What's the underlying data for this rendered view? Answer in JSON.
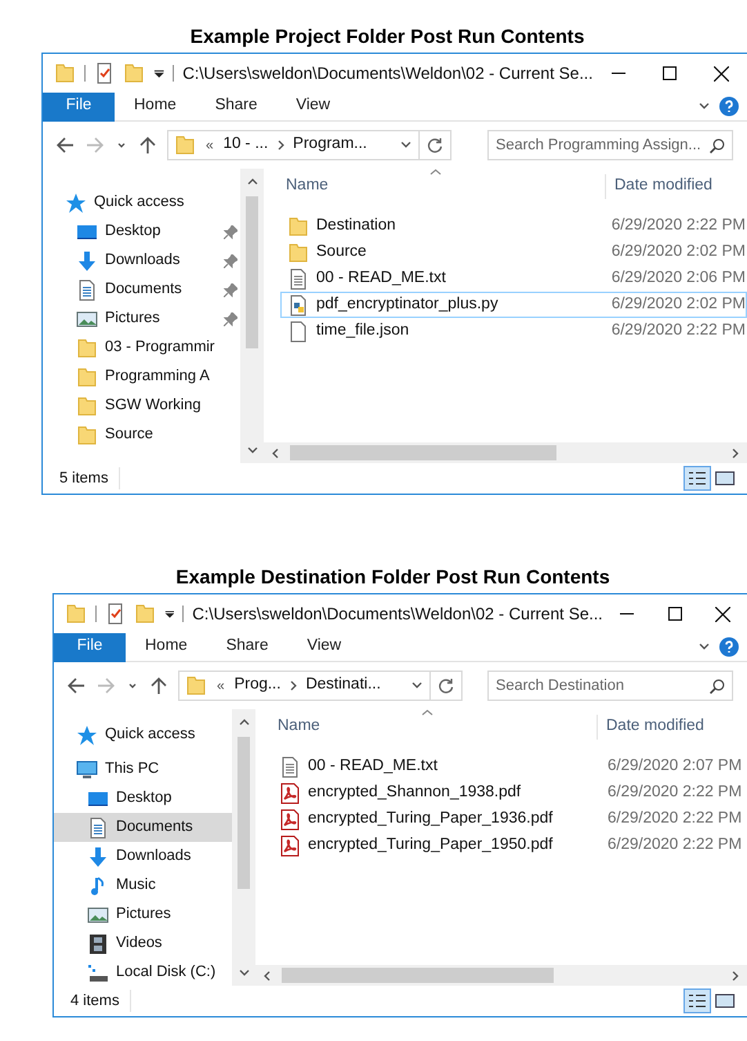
{
  "panels": [
    {
      "caption": "Example Project Folder Post Run Contents",
      "window": {
        "title": "C:\\Users\\sweldon\\Documents\\Weldon\\02 - Current Se...",
        "ribbon_tabs": [
          {
            "label": "File",
            "selected": true
          },
          {
            "label": "Home",
            "selected": false
          },
          {
            "label": "Share",
            "selected": false
          },
          {
            "label": "View",
            "selected": false
          }
        ],
        "address": {
          "overflow": "«",
          "crumbs": [
            "10 - ...",
            "Program..."
          ]
        },
        "search": {
          "placeholder": "Search Programming Assign..."
        },
        "sidebar": [
          {
            "label": "Quick access",
            "kind": "quick-access",
            "pinned": false,
            "selected": false,
            "children": [
              {
                "label": "Desktop",
                "kind": "desktop",
                "pinned": true,
                "selected": false
              },
              {
                "label": "Downloads",
                "kind": "downloads",
                "pinned": true,
                "selected": false
              },
              {
                "label": "Documents",
                "kind": "documents",
                "pinned": true,
                "selected": false
              },
              {
                "label": "Pictures",
                "kind": "pictures",
                "pinned": true,
                "selected": false
              },
              {
                "label": "03 - Programmir",
                "kind": "folder",
                "pinned": false,
                "selected": false
              },
              {
                "label": "Programming A",
                "kind": "folder",
                "pinned": false,
                "selected": false
              },
              {
                "label": "SGW Working",
                "kind": "folder",
                "pinned": false,
                "selected": false
              },
              {
                "label": "Source",
                "kind": "folder",
                "pinned": false,
                "selected": false
              }
            ]
          }
        ],
        "columns": [
          "Name",
          "Date modified"
        ],
        "files": [
          {
            "name": "Destination",
            "kind": "folder",
            "date": "6/29/2020 2:22 PM",
            "selected": false
          },
          {
            "name": "Source",
            "kind": "folder",
            "date": "6/29/2020 2:02 PM",
            "selected": false
          },
          {
            "name": "00 - READ_ME.txt",
            "kind": "text",
            "date": "6/29/2020 2:06 PM",
            "selected": false
          },
          {
            "name": "pdf_encryptinator_plus.py",
            "kind": "python",
            "date": "6/29/2020 2:02 PM",
            "selected": true
          },
          {
            "name": "time_file.json",
            "kind": "blank",
            "date": "6/29/2020 2:22 PM",
            "selected": false
          }
        ],
        "status": "5 items",
        "view_buttons": [
          {
            "kind": "details",
            "selected": true
          },
          {
            "kind": "large-icons",
            "selected": false
          }
        ]
      }
    },
    {
      "caption": "Example Destination Folder Post Run Contents",
      "window": {
        "title": "C:\\Users\\sweldon\\Documents\\Weldon\\02 - Current Se...",
        "ribbon_tabs": [
          {
            "label": "File",
            "selected": true
          },
          {
            "label": "Home",
            "selected": false
          },
          {
            "label": "Share",
            "selected": false
          },
          {
            "label": "View",
            "selected": false
          }
        ],
        "address": {
          "overflow": "«",
          "crumbs": [
            "Prog...",
            "Destinati..."
          ]
        },
        "search": {
          "placeholder": "Search Destination"
        },
        "sidebar": [
          {
            "label": "Quick access",
            "kind": "quick-access",
            "pinned": false,
            "selected": false
          },
          {
            "label": "This PC",
            "kind": "this-pc",
            "pinned": false,
            "selected": false,
            "children": [
              {
                "label": "Desktop",
                "kind": "desktop",
                "pinned": false,
                "selected": false
              },
              {
                "label": "Documents",
                "kind": "documents",
                "pinned": false,
                "selected": true
              },
              {
                "label": "Downloads",
                "kind": "downloads",
                "pinned": false,
                "selected": false
              },
              {
                "label": "Music",
                "kind": "music",
                "pinned": false,
                "selected": false
              },
              {
                "label": "Pictures",
                "kind": "pictures",
                "pinned": false,
                "selected": false
              },
              {
                "label": "Videos",
                "kind": "videos",
                "pinned": false,
                "selected": false
              },
              {
                "label": "Local Disk (C:)",
                "kind": "disk",
                "pinned": false,
                "selected": false
              }
            ]
          }
        ],
        "columns": [
          "Name",
          "Date modified"
        ],
        "files": [
          {
            "name": "00 - READ_ME.txt",
            "kind": "text",
            "date": "6/29/2020 2:07 PM",
            "selected": false
          },
          {
            "name": "encrypted_Shannon_1938.pdf",
            "kind": "pdf",
            "date": "6/29/2020 2:22 PM",
            "selected": false
          },
          {
            "name": "encrypted_Turing_Paper_1936.pdf",
            "kind": "pdf",
            "date": "6/29/2020 2:22 PM",
            "selected": false
          },
          {
            "name": "encrypted_Turing_Paper_1950.pdf",
            "kind": "pdf",
            "date": "6/29/2020 2:22 PM",
            "selected": false
          }
        ],
        "status": "4 items",
        "view_buttons": [
          {
            "kind": "details",
            "selected": true
          },
          {
            "kind": "large-icons",
            "selected": false
          }
        ]
      }
    }
  ]
}
